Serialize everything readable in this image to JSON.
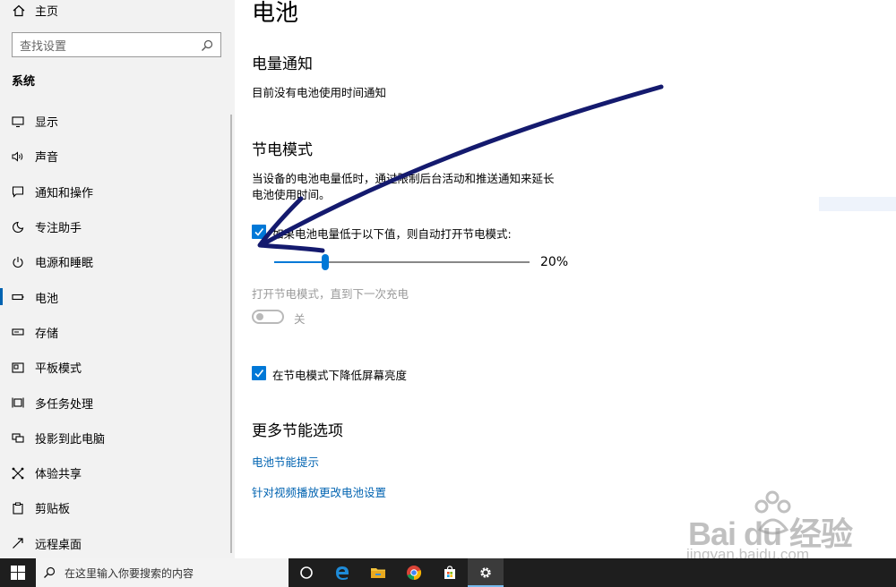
{
  "sidebar": {
    "home_label": "主页",
    "search_placeholder": "查找设置",
    "section_title": "系统",
    "items": [
      {
        "label": "显示",
        "icon": "monitor-icon"
      },
      {
        "label": "声音",
        "icon": "speaker-icon"
      },
      {
        "label": "通知和操作",
        "icon": "notification-icon"
      },
      {
        "label": "专注助手",
        "icon": "moon-icon"
      },
      {
        "label": "电源和睡眠",
        "icon": "power-icon"
      },
      {
        "label": "电池",
        "icon": "battery-icon",
        "active": true
      },
      {
        "label": "存储",
        "icon": "storage-icon"
      },
      {
        "label": "平板模式",
        "icon": "tablet-icon"
      },
      {
        "label": "多任务处理",
        "icon": "multitask-icon"
      },
      {
        "label": "投影到此电脑",
        "icon": "project-icon"
      },
      {
        "label": "体验共享",
        "icon": "share-icon"
      },
      {
        "label": "剪贴板",
        "icon": "clipboard-icon"
      },
      {
        "label": "远程桌面",
        "icon": "remote-desktop-icon"
      }
    ]
  },
  "main": {
    "page_title": "电池",
    "notifications": {
      "heading": "电量通知",
      "text": "目前没有电池使用时间通知"
    },
    "saver": {
      "heading": "节电模式",
      "description_line1": "当设备的电池电量低时，通过限制后台活动和推送通知来延长",
      "description_line2": "电池使用时间。",
      "auto_checkbox_label": "如果电池电量低于以下值，则自动打开节电模式:",
      "auto_checked": true,
      "slider_value": 20,
      "slider_value_label": "20%",
      "toggle_title": "打开节电模式，直到下一次充电",
      "toggle_state_label": "关",
      "toggle_on": false,
      "brightness_checkbox_label": "在节电模式下降低屏幕亮度",
      "brightness_checked": true
    },
    "more": {
      "heading": "更多节能选项",
      "link1": "电池节能提示",
      "link2": "针对视频播放更改电池设置"
    }
  },
  "taskbar": {
    "search_placeholder": "在这里输入你要搜索的内容",
    "apps": [
      "cortana-icon",
      "edge-icon",
      "file-explorer-icon",
      "chrome-icon",
      "store-icon",
      "settings-icon"
    ],
    "active_app": "settings-icon"
  },
  "watermark": {
    "top": "Bai du 经验",
    "bottom": "jingyan.baidu.com"
  },
  "colors": {
    "accent": "#0078d7",
    "link": "#0063b1",
    "annotation_arrow": "#141a6e",
    "taskbar": "#1e1e1e"
  }
}
